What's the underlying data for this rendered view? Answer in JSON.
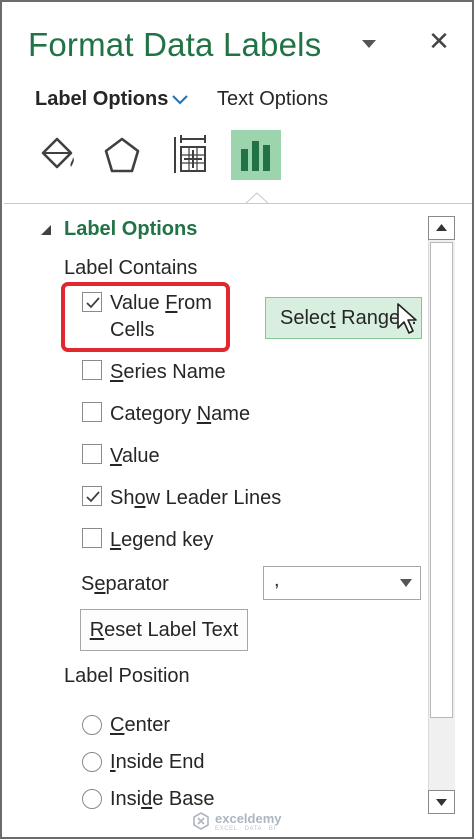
{
  "pane": {
    "title": "Format Data Labels",
    "close_glyph": "✕"
  },
  "tabs": {
    "label_options": "Label Options",
    "text_options": "Text Options"
  },
  "icon_tabs": [
    {
      "name": "fill-line-icon",
      "selected": false
    },
    {
      "name": "effects-pentagon-icon",
      "selected": false
    },
    {
      "name": "size-properties-icon",
      "selected": false
    },
    {
      "name": "label-options-bar-chart-icon",
      "selected": true
    }
  ],
  "section": {
    "title": "Label Options",
    "label_contains": "Label Contains",
    "label_position": "Label Position"
  },
  "checkboxes": [
    {
      "pre": "Value ",
      "key": "F",
      "post": "rom",
      "line2": "Cells",
      "checked": true
    },
    {
      "pre": "",
      "key": "S",
      "post": "eries Name",
      "checked": false
    },
    {
      "pre": "Category ",
      "key": "N",
      "post": "ame",
      "checked": false
    },
    {
      "pre": "",
      "key": "V",
      "post": "alue",
      "checked": false
    },
    {
      "pre": "Sh",
      "key": "o",
      "post": "w Leader Lines",
      "checked": true
    },
    {
      "pre": "",
      "key": "L",
      "post": "egend key",
      "checked": false
    }
  ],
  "select_range": {
    "pre": "Selec",
    "key": "t",
    "post": " Range..."
  },
  "separator": {
    "label_pre": "S",
    "label_key": "e",
    "label_post": "parator",
    "value": ","
  },
  "reset_button": {
    "pre": "",
    "key": "R",
    "post": "eset Label Text"
  },
  "radios": [
    {
      "pre": "",
      "key": "C",
      "post": "enter",
      "selected": false
    },
    {
      "pre": "",
      "key": "I",
      "post": "nside End",
      "selected": false
    },
    {
      "pre": "Insi",
      "key": "d",
      "post": "e Base",
      "selected": false
    }
  ],
  "watermark": {
    "brand": "exceldemy",
    "tagline": "EXCEL · DATA · BI"
  },
  "colors": {
    "accent": "#217346",
    "selected_tab": "#9bd4ad",
    "highlight": "#e2272f",
    "select_range_bg": "#d8efdf"
  }
}
